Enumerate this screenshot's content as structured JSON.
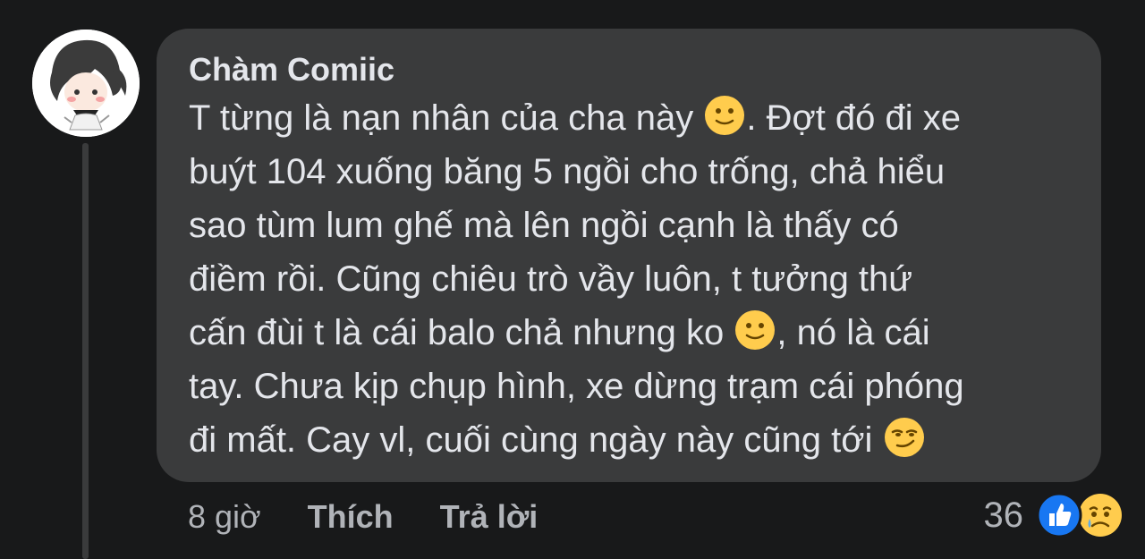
{
  "comment": {
    "author": "Chàm Comiic",
    "text_parts": [
      "T từng là nạn nhân của cha này ",
      ". Đợt đó đi xe\nbuýt 104 xuống băng 5 ngồi cho trống, chả hiểu\nsao tùm lum ghế mà lên ngồi cạnh là thấy có\nđiềm rồi. Cũng chiêu trò vầy luôn, t tưởng thứ\ncấn đùi t là cái balo chả nhưng ko ",
      ", nó là cái\ntay. Chưa kịp chụp hình, xe dừng trạm cái phóng\nđi mất. Cay vl, cuối cùng ngày này cũng tới "
    ],
    "emojis": [
      "slightly-smiling-face",
      "slightly-smiling-face",
      "smirking-face"
    ]
  },
  "meta": {
    "time": "8 giờ",
    "like_label": "Thích",
    "reply_label": "Trả lời"
  },
  "reactions": {
    "count": "36",
    "types": [
      "like",
      "sad"
    ]
  },
  "colors": {
    "background": "#18191a",
    "bubble": "#3a3b3c",
    "text": "#e4e6eb",
    "muted": "#b0b3b8",
    "like_blue": "#1877f2",
    "emoji_yellow": "#ffcc4d"
  }
}
